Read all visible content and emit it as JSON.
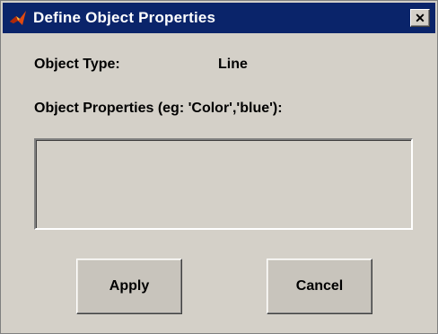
{
  "window": {
    "title": "Define Object Properties",
    "close_symbol": "✕",
    "icon": "matlab-icon"
  },
  "fields": {
    "object_type_label": "Object Type:",
    "object_type_value": "Line",
    "properties_label": "Object Properties (eg: 'Color','blue'):",
    "properties_value": ""
  },
  "buttons": {
    "apply_label": "Apply",
    "cancel_label": "Cancel"
  },
  "colors": {
    "titlebar": "#0a246a",
    "face": "#d4d0c8"
  }
}
